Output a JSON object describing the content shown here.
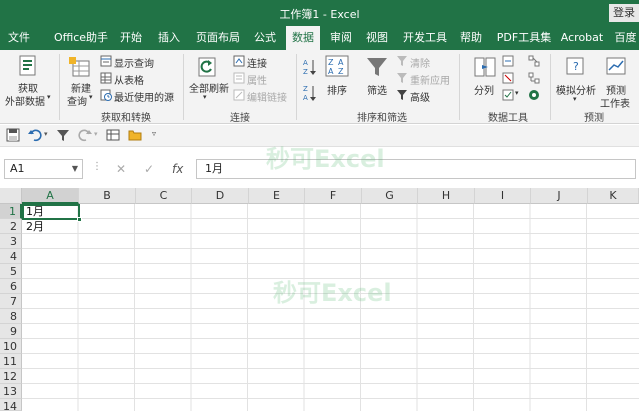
{
  "window": {
    "title": "工作簿1 - Excel",
    "login_label": "登录"
  },
  "tabs": [
    "文件",
    "Office助手",
    "开始",
    "插入",
    "页面布局",
    "公式",
    "数据",
    "审阅",
    "视图",
    "开发工具",
    "帮助",
    "PDF工具集",
    "Acrobat",
    "百度"
  ],
  "active_tab": "数据",
  "ribbon": {
    "get_external_data": [
      "获取",
      "外部数据"
    ],
    "new_query": [
      "新建",
      "查询"
    ],
    "show_query": "显示查询",
    "from_table": "从表格",
    "recent_sources": "最近使用的源",
    "group_get_transform": "获取和转换",
    "refresh_all": [
      "全部刷新"
    ],
    "connections": "连接",
    "properties": "属性",
    "edit_links": "编辑链接",
    "group_connections": "连接",
    "sort": "排序",
    "filter": "筛选",
    "clear": "清除",
    "reapply": "重新应用",
    "advanced": "高级",
    "group_sort_filter": "排序和筛选",
    "text_to_columns": "分列",
    "group_data_tools": "数据工具",
    "what_if": "模拟分析",
    "forecast_sheet": [
      "预测",
      "工作表"
    ],
    "group_forecast": "预测"
  },
  "formula_bar": {
    "name_box": "A1",
    "fx": "fx",
    "value": "1月"
  },
  "columns": [
    "A",
    "B",
    "C",
    "D",
    "E",
    "F",
    "G",
    "H",
    "I",
    "J",
    "K"
  ],
  "rows": [
    "1",
    "2",
    "3",
    "4",
    "5",
    "6",
    "7",
    "8",
    "9",
    "10",
    "11",
    "12",
    "13",
    "14"
  ],
  "cells": {
    "A1": "1月",
    "A2": "2月"
  },
  "watermark": "秒可Excel",
  "colors": {
    "excel_green": "#217346",
    "ribbon_bg": "#f3f3f3"
  },
  "icons": {
    "undo": "undo-icon",
    "redo": "redo-icon",
    "save": "save-icon",
    "filter": "filter-icon",
    "folder": "folder-icon"
  }
}
